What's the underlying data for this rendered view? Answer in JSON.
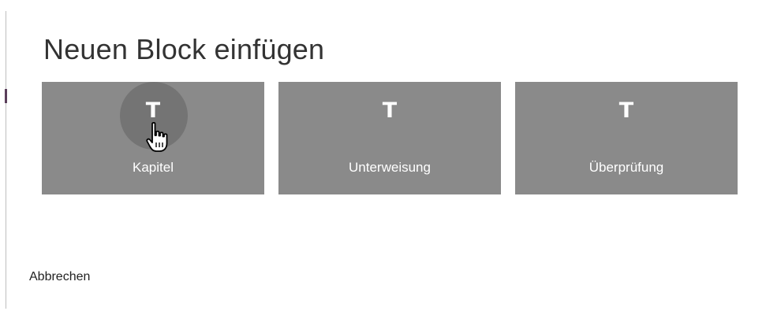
{
  "dialog": {
    "title": "Neuen Block einfügen",
    "cancel_label": "Abbrechen"
  },
  "blocks": [
    {
      "icon_glyph": "T",
      "icon": "text-icon",
      "label": "Kapitel",
      "hovered": true
    },
    {
      "icon_glyph": "T",
      "icon": "text-icon",
      "label": "Unterweisung",
      "hovered": false
    },
    {
      "icon_glyph": "T",
      "icon": "text-icon",
      "label": "Überprüfung",
      "hovered": false
    }
  ],
  "colors": {
    "tile_background": "#8a8a8a",
    "tile_text": "#ffffff",
    "title_text": "#333333"
  }
}
